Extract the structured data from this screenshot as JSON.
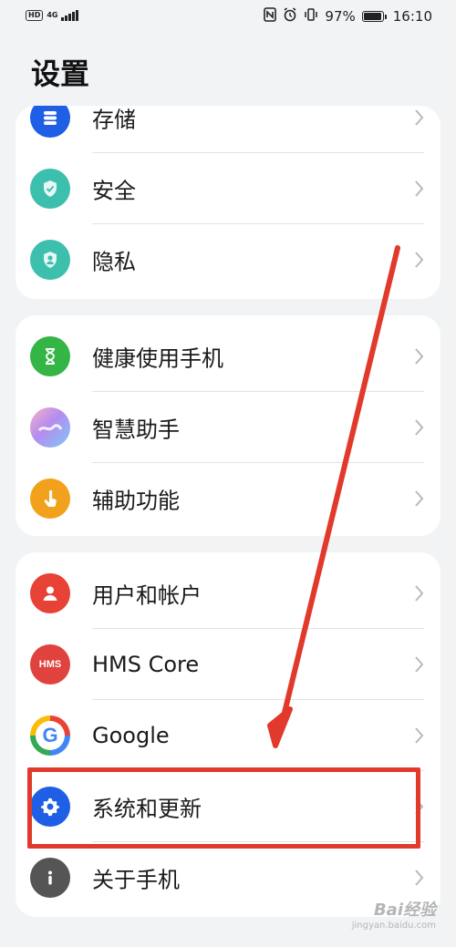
{
  "status_bar": {
    "hd": "HD",
    "network": "4G",
    "battery_text": "97%",
    "battery_level": 0.97,
    "time": "16:10"
  },
  "page": {
    "title": "设置"
  },
  "groups": [
    {
      "items": [
        {
          "label": "存储",
          "icon": "storage-icon",
          "color": "#1e5fe6"
        },
        {
          "label": "安全",
          "icon": "shield-icon",
          "color": "#3dbfae"
        },
        {
          "label": "隐私",
          "icon": "privacy-icon",
          "color": "#3dbfae"
        }
      ]
    },
    {
      "items": [
        {
          "label": "健康使用手机",
          "icon": "hourglass-icon",
          "color": "#35b546"
        },
        {
          "label": "智慧助手",
          "icon": "assistant-icon",
          "color": "#b48cf0"
        },
        {
          "label": "辅助功能",
          "icon": "accessibility-hand-icon",
          "color": "#f2a11c"
        }
      ]
    },
    {
      "items": [
        {
          "label": "用户和帐户",
          "icon": "user-icon",
          "color": "#e74235"
        },
        {
          "label": "HMS Core",
          "icon": "hms-icon",
          "icon_text": "HMS",
          "color": "#e0433e"
        },
        {
          "label": "Google",
          "icon": "google-icon",
          "icon_text": "G",
          "color": "#ffffff"
        },
        {
          "label": "系统和更新",
          "icon": "gear-icon",
          "color": "#1e5fe6"
        },
        {
          "label": "关于手机",
          "icon": "info-icon",
          "color": "#555555"
        }
      ]
    }
  ],
  "annotation": {
    "highlight_color": "#e1392b",
    "highlighted_item": "系统和更新"
  },
  "watermark": {
    "text": "Bai经验",
    "sub": "jingyan.baidu.com"
  }
}
